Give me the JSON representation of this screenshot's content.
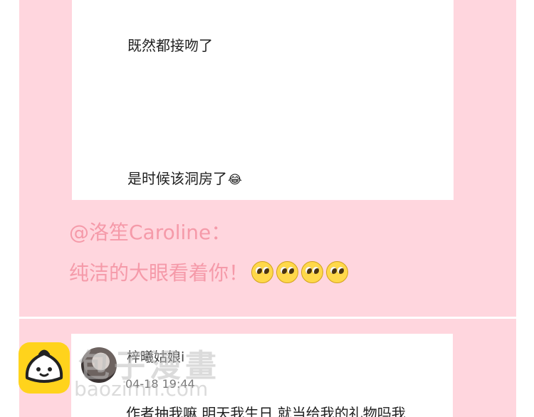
{
  "post_card": {
    "line1": "既然都接吻了",
    "line2": "是时候该洞房了",
    "line2_emoji": "😂"
  },
  "reply_block": {
    "mention": "@洛笙Caroline：",
    "reply_text": "纯洁的大眼看着你！",
    "emoji_count": 4,
    "emoji_name": "puppy-eyes-face-icon"
  },
  "comment_card": {
    "username": "梓曦姑娘i",
    "timestamp": "04-18 19:44",
    "text": "作者抽我嘛 明天我生日 就当给我的礼物吗我"
  },
  "watermark": {
    "name": "包子漫畫",
    "url": "baozimh.com"
  },
  "colors": {
    "panel_pink": "#ffd6de",
    "reply_pink": "#f59aa9",
    "logo_yellow": "#ffd31c"
  }
}
